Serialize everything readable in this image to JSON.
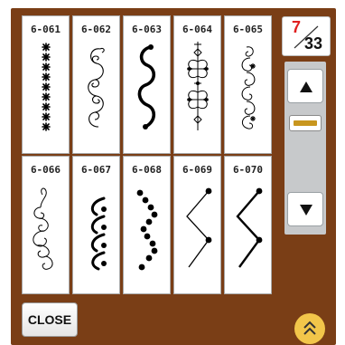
{
  "patterns": [
    {
      "id": "6-061",
      "icon": "asterisk-column-pattern-icon"
    },
    {
      "id": "6-062",
      "icon": "scroll-swirl-pattern-icon"
    },
    {
      "id": "6-063",
      "icon": "bold-s-curve-pattern-icon"
    },
    {
      "id": "6-064",
      "icon": "ornamental-cross-pattern-icon"
    },
    {
      "id": "6-065",
      "icon": "spiral-star-pattern-icon"
    },
    {
      "id": "6-066",
      "icon": "loop-curl-pattern-icon"
    },
    {
      "id": "6-067",
      "icon": "crescent-dot-pattern-icon"
    },
    {
      "id": "6-068",
      "icon": "dotted-zigzag-pattern-icon"
    },
    {
      "id": "6-069",
      "icon": "zigzag-dot-pattern-icon"
    },
    {
      "id": "6-070",
      "icon": "double-zigzag-dot-pattern-icon"
    }
  ],
  "page_indicator": {
    "current": "7",
    "total": "33"
  },
  "scroll": {
    "up_icon": "triangle-up-icon",
    "down_icon": "triangle-down-icon",
    "position_fraction": 0.18
  },
  "close_label": "CLOSE",
  "collapse_icon": "double-chevron-up-icon",
  "colors": {
    "panel": "#7a3e16",
    "accent": "#c8961e",
    "page_current": "#e02020",
    "collapse_button": "#f2c64a"
  }
}
